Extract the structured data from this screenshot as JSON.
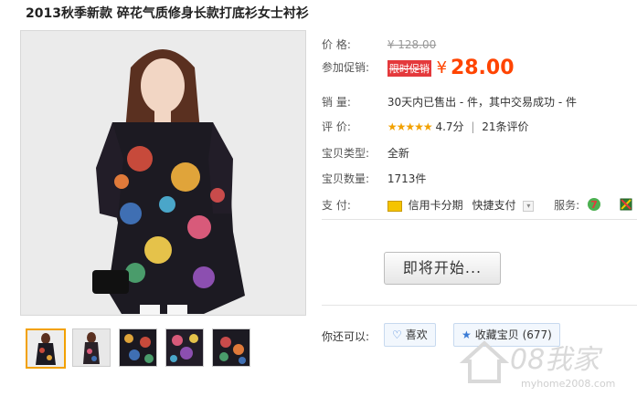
{
  "product": {
    "title": "2013秋季新款 碎花气质修身长款打底衫女士衬衫"
  },
  "thumbnails": [
    {
      "name": "thumb-1",
      "active": true
    },
    {
      "name": "thumb-2",
      "active": false
    },
    {
      "name": "thumb-3",
      "active": false
    },
    {
      "name": "thumb-4",
      "active": false
    },
    {
      "name": "thumb-5",
      "active": false
    }
  ],
  "price": {
    "label": "价      格:",
    "original": "¥ 128.00"
  },
  "promo": {
    "label": "参加促销:",
    "tag": "限时促销",
    "currency": "¥",
    "value": "28.00"
  },
  "sales": {
    "label": "销      量:",
    "text": "30天内已售出 - 件，其中交易成功 - 件"
  },
  "rating": {
    "label": "评      价:",
    "stars": "★★★★★",
    "score": "4.7分",
    "separator": "|",
    "reviews": "21条评价"
  },
  "type": {
    "label": "宝贝类型:",
    "value": "全新"
  },
  "quantity": {
    "label": "宝贝数量:",
    "value": "1713件"
  },
  "payment": {
    "label": "支      付:",
    "method": "信用卡分期",
    "quick": "快捷支付",
    "service_label": "服务:"
  },
  "buy_button": "即将开始...",
  "share": {
    "label": "你还可以:",
    "like": "喜欢",
    "favorite": "收藏宝贝 (677)"
  },
  "watermark": {
    "brand": "08我家",
    "url": "myhome2008.com"
  },
  "colors": {
    "promo_red": "#e4393c",
    "price_orange": "#ff4400",
    "star_gold": "#f2a100"
  }
}
